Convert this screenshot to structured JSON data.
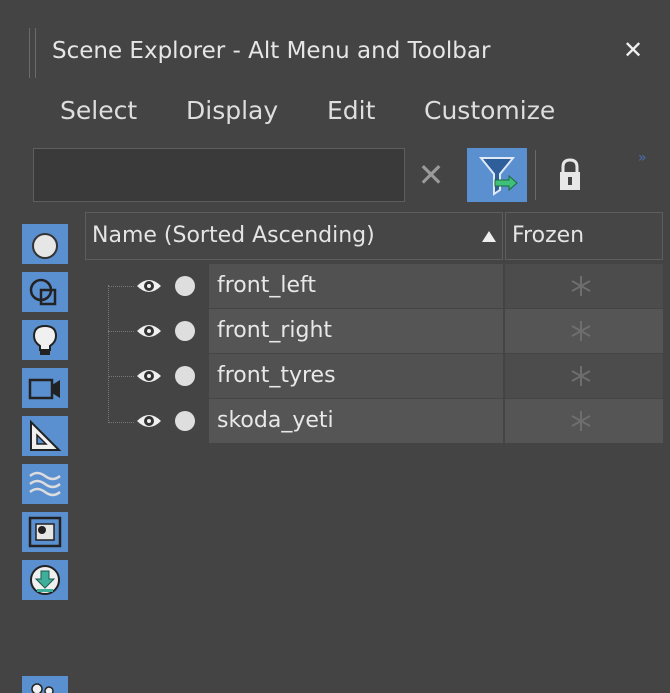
{
  "window": {
    "title": "Scene Explorer - Alt Menu and Toolbar",
    "close_glyph": "✕"
  },
  "menu": {
    "items": [
      "Select",
      "Display",
      "Edit",
      "Customize"
    ]
  },
  "toolbar": {
    "search_value": "",
    "clear_glyph": "✕",
    "more_glyph": "»",
    "accent_color": "#5a8fd0"
  },
  "left_toolbar": {
    "buttons": [
      "geometry-icon",
      "shapes-icon",
      "lights-icon",
      "cameras-icon",
      "helpers-icon",
      "space-warps-icon",
      "groups-icon",
      "xrefs-icon",
      "bones-icon"
    ]
  },
  "columns": {
    "name": "Name (Sorted Ascending)",
    "frozen": "Frozen"
  },
  "rows": [
    {
      "name": "front_left"
    },
    {
      "name": "front_right"
    },
    {
      "name": "front_tyres"
    },
    {
      "name": "skoda_yeti"
    }
  ]
}
